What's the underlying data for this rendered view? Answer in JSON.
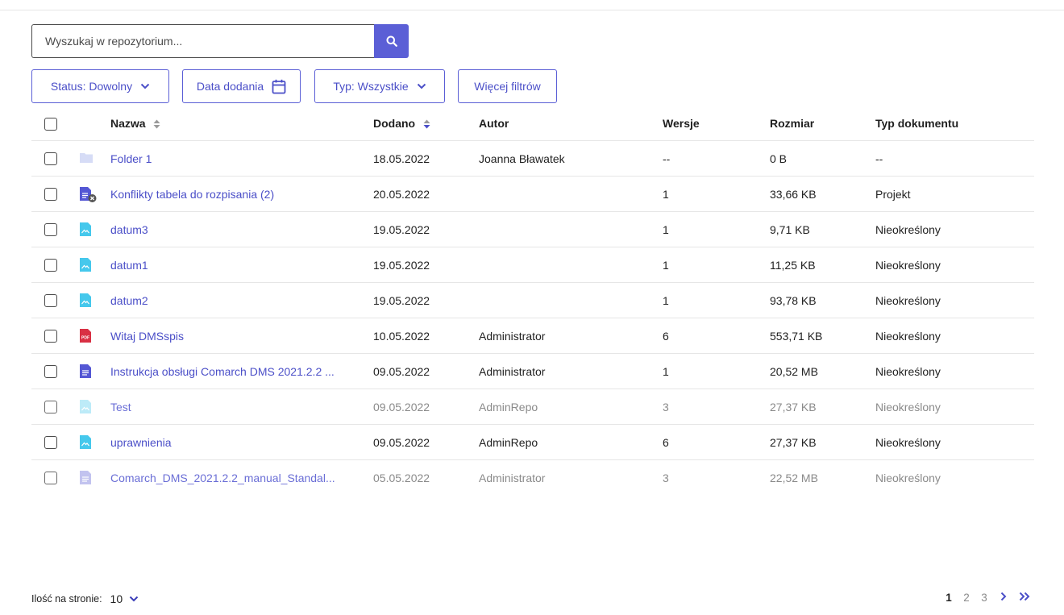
{
  "search": {
    "placeholder": "Wyszukaj w repozytorium...",
    "accent": "#5b5fd6"
  },
  "filters": {
    "status": "Status: Dowolny",
    "date_added": "Data dodania",
    "type": "Typ: Wszystkie",
    "more": "Więcej filtrów"
  },
  "table": {
    "headers": {
      "name": "Nazwa",
      "added": "Dodano",
      "author": "Autor",
      "versions": "Wersje",
      "size": "Rozmiar",
      "doc_type": "Typ dokumentu"
    },
    "rows": [
      {
        "icon": "folder-icon",
        "name": "Folder 1",
        "added": "18.05.2022",
        "author": "Joanna Bławatek",
        "versions": "--",
        "size": "0 B",
        "doc_type": "--",
        "dimmed": false
      },
      {
        "icon": "document-locked-icon",
        "name": "Konflikty tabela do rozpisania (2)",
        "added": "20.05.2022",
        "author": "",
        "versions": "1",
        "size": "33,66 KB",
        "doc_type": "Projekt",
        "dimmed": false
      },
      {
        "icon": "image-file-icon",
        "name": "datum3",
        "added": "19.05.2022",
        "author": "",
        "versions": "1",
        "size": "9,71 KB",
        "doc_type": "Nieokreślony",
        "dimmed": false
      },
      {
        "icon": "image-file-icon",
        "name": "datum1",
        "added": "19.05.2022",
        "author": "",
        "versions": "1",
        "size": "11,25 KB",
        "doc_type": "Nieokreślony",
        "dimmed": false
      },
      {
        "icon": "image-file-icon",
        "name": "datum2",
        "added": "19.05.2022",
        "author": "",
        "versions": "1",
        "size": "93,78 KB",
        "doc_type": "Nieokreślony",
        "dimmed": false
      },
      {
        "icon": "pdf-file-icon",
        "name": "Witaj DMSspis",
        "added": "10.05.2022",
        "author": "Administrator",
        "versions": "6",
        "size": "553,71 KB",
        "doc_type": "Nieokreślony",
        "dimmed": false
      },
      {
        "icon": "document-icon",
        "name": "Instrukcja obsługi Comarch DMS 2021.2.2 ...",
        "added": "09.05.2022",
        "author": "Administrator",
        "versions": "1",
        "size": "20,52 MB",
        "doc_type": "Nieokreślony",
        "dimmed": false
      },
      {
        "icon": "image-file-icon",
        "name": "Test",
        "added": "09.05.2022",
        "author": "AdminRepo",
        "versions": "3",
        "size": "27,37 KB",
        "doc_type": "Nieokreślony",
        "dimmed": true
      },
      {
        "icon": "image-file-icon",
        "name": "uprawnienia",
        "added": "09.05.2022",
        "author": "AdminRepo",
        "versions": "6",
        "size": "27,37 KB",
        "doc_type": "Nieokreślony",
        "dimmed": false
      },
      {
        "icon": "document-icon",
        "name": "Comarch_DMS_2021.2.2_manual_Standal...",
        "added": "05.05.2022",
        "author": "Administrator",
        "versions": "3",
        "size": "22,52 MB",
        "doc_type": "Nieokreślony",
        "dimmed": true
      }
    ]
  },
  "footer": {
    "per_page_label": "Ilość na stronie:",
    "per_page_value": "10",
    "pages": [
      "1",
      "2",
      "3"
    ],
    "current_page": "1"
  },
  "colors": {
    "accent": "#5b5fd6",
    "link": "#4b4fc8",
    "image_icon": "#45c8ec",
    "pdf_icon": "#d93044",
    "folder_icon": "#d6dcf6"
  }
}
